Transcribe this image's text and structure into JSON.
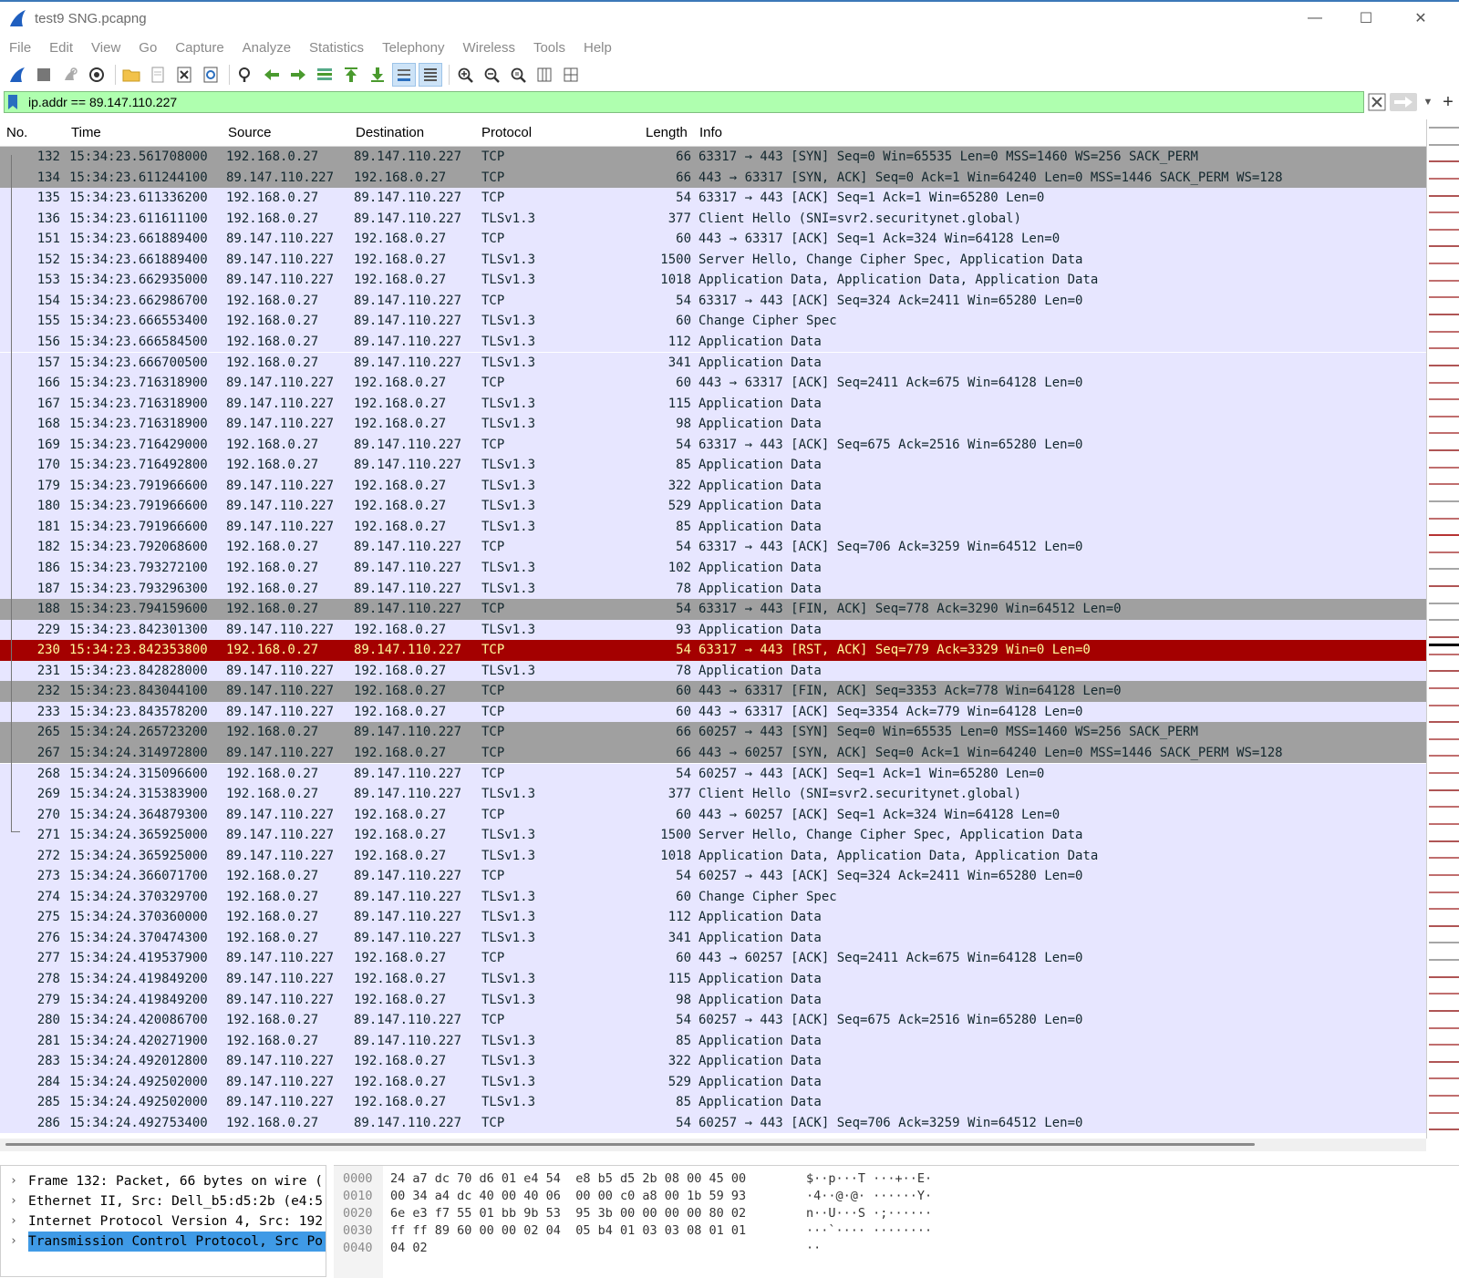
{
  "window": {
    "title": "test9 SNG.pcapng",
    "controls": {
      "minimize": "—",
      "maximize": "☐",
      "close": "✕"
    }
  },
  "menu": [
    "File",
    "Edit",
    "View",
    "Go",
    "Capture",
    "Analyze",
    "Statistics",
    "Telephony",
    "Wireless",
    "Tools",
    "Help"
  ],
  "toolbar": {
    "icons": [
      "shark-fin-start-icon",
      "stop-square-icon",
      "restart-icon",
      "capture-options-icon",
      "open-folder-icon",
      "save-file-icon",
      "close-file-icon",
      "reload-icon",
      "find-icon",
      "go-back-icon",
      "go-forward-icon",
      "go-to-packet-icon",
      "first-packet-icon",
      "last-packet-icon",
      "autoscroll-icon",
      "colorize-icon",
      "zoom-in-icon",
      "zoom-out-icon",
      "zoom-normal-icon",
      "resize-columns-icon",
      "layout-icon"
    ]
  },
  "filter": {
    "value": "ip.addr == 89.147.110.227",
    "add_button": "+"
  },
  "columns": {
    "no": "No.",
    "time": "Time",
    "source": "Source",
    "destination": "Destination",
    "protocol": "Protocol",
    "length": "Length",
    "info": "Info"
  },
  "colors": {
    "row_default": "#e7e6ff",
    "row_syn_fin": "#a0a0a0",
    "row_rst": "#a40000",
    "rst_text": "#fffc9c",
    "filter_bg": "#afffaf",
    "selected_detail": "#3f9ae6"
  },
  "packets": [
    {
      "no": "132",
      "time": "15:34:23.561708000",
      "src": "192.168.0.27",
      "dst": "89.147.110.227",
      "proto": "TCP",
      "len": "66",
      "info": "63317 → 443 [SYN] Seq=0 Win=65535 Len=0 MSS=1460 WS=256 SACK_PERM",
      "style": "syn"
    },
    {
      "no": "134",
      "time": "15:34:23.611244100",
      "src": "89.147.110.227",
      "dst": "192.168.0.27",
      "proto": "TCP",
      "len": "66",
      "info": "443 → 63317 [SYN, ACK] Seq=0 Ack=1 Win=64240 Len=0 MSS=1446 SACK_PERM WS=128",
      "style": "syn"
    },
    {
      "no": "135",
      "time": "15:34:23.611336200",
      "src": "192.168.0.27",
      "dst": "89.147.110.227",
      "proto": "TCP",
      "len": "54",
      "info": "63317 → 443 [ACK] Seq=1 Ack=1 Win=65280 Len=0",
      "style": "tcp"
    },
    {
      "no": "136",
      "time": "15:34:23.611611100",
      "src": "192.168.0.27",
      "dst": "89.147.110.227",
      "proto": "TLSv1.3",
      "len": "377",
      "info": "Client Hello (SNI=svr2.securitynet.global)",
      "style": "tls"
    },
    {
      "no": "151",
      "time": "15:34:23.661889400",
      "src": "89.147.110.227",
      "dst": "192.168.0.27",
      "proto": "TCP",
      "len": "60",
      "info": "443 → 63317 [ACK] Seq=1 Ack=324 Win=64128 Len=0",
      "style": "tcp"
    },
    {
      "no": "152",
      "time": "15:34:23.661889400",
      "src": "89.147.110.227",
      "dst": "192.168.0.27",
      "proto": "TLSv1.3",
      "len": "1500",
      "info": "Server Hello, Change Cipher Spec, Application Data",
      "style": "tls"
    },
    {
      "no": "153",
      "time": "15:34:23.662935000",
      "src": "89.147.110.227",
      "dst": "192.168.0.27",
      "proto": "TLSv1.3",
      "len": "1018",
      "info": "Application Data, Application Data, Application Data",
      "style": "tls"
    },
    {
      "no": "154",
      "time": "15:34:23.662986700",
      "src": "192.168.0.27",
      "dst": "89.147.110.227",
      "proto": "TCP",
      "len": "54",
      "info": "63317 → 443 [ACK] Seq=324 Ack=2411 Win=65280 Len=0",
      "style": "tcp"
    },
    {
      "no": "155",
      "time": "15:34:23.666553400",
      "src": "192.168.0.27",
      "dst": "89.147.110.227",
      "proto": "TLSv1.3",
      "len": "60",
      "info": "Change Cipher Spec",
      "style": "tls"
    },
    {
      "no": "156",
      "time": "15:34:23.666584500",
      "src": "192.168.0.27",
      "dst": "89.147.110.227",
      "proto": "TLSv1.3",
      "len": "112",
      "info": "Application Data",
      "style": "tls"
    },
    {
      "no": "157",
      "time": "15:34:23.666700500",
      "src": "192.168.0.27",
      "dst": "89.147.110.227",
      "proto": "TLSv1.3",
      "len": "341",
      "info": "Application Data",
      "style": "tls"
    },
    {
      "no": "166",
      "time": "15:34:23.716318900",
      "src": "89.147.110.227",
      "dst": "192.168.0.27",
      "proto": "TCP",
      "len": "60",
      "info": "443 → 63317 [ACK] Seq=2411 Ack=675 Win=64128 Len=0",
      "style": "tcp"
    },
    {
      "no": "167",
      "time": "15:34:23.716318900",
      "src": "89.147.110.227",
      "dst": "192.168.0.27",
      "proto": "TLSv1.3",
      "len": "115",
      "info": "Application Data",
      "style": "tls"
    },
    {
      "no": "168",
      "time": "15:34:23.716318900",
      "src": "89.147.110.227",
      "dst": "192.168.0.27",
      "proto": "TLSv1.3",
      "len": "98",
      "info": "Application Data",
      "style": "tls"
    },
    {
      "no": "169",
      "time": "15:34:23.716429000",
      "src": "192.168.0.27",
      "dst": "89.147.110.227",
      "proto": "TCP",
      "len": "54",
      "info": "63317 → 443 [ACK] Seq=675 Ack=2516 Win=65280 Len=0",
      "style": "tcp"
    },
    {
      "no": "170",
      "time": "15:34:23.716492800",
      "src": "192.168.0.27",
      "dst": "89.147.110.227",
      "proto": "TLSv1.3",
      "len": "85",
      "info": "Application Data",
      "style": "tls"
    },
    {
      "no": "179",
      "time": "15:34:23.791966600",
      "src": "89.147.110.227",
      "dst": "192.168.0.27",
      "proto": "TLSv1.3",
      "len": "322",
      "info": "Application Data",
      "style": "tls"
    },
    {
      "no": "180",
      "time": "15:34:23.791966600",
      "src": "89.147.110.227",
      "dst": "192.168.0.27",
      "proto": "TLSv1.3",
      "len": "529",
      "info": "Application Data",
      "style": "tls"
    },
    {
      "no": "181",
      "time": "15:34:23.791966600",
      "src": "89.147.110.227",
      "dst": "192.168.0.27",
      "proto": "TLSv1.3",
      "len": "85",
      "info": "Application Data",
      "style": "tls"
    },
    {
      "no": "182",
      "time": "15:34:23.792068600",
      "src": "192.168.0.27",
      "dst": "89.147.110.227",
      "proto": "TCP",
      "len": "54",
      "info": "63317 → 443 [ACK] Seq=706 Ack=3259 Win=64512 Len=0",
      "style": "tcp"
    },
    {
      "no": "186",
      "time": "15:34:23.793272100",
      "src": "192.168.0.27",
      "dst": "89.147.110.227",
      "proto": "TLSv1.3",
      "len": "102",
      "info": "Application Data",
      "style": "tls"
    },
    {
      "no": "187",
      "time": "15:34:23.793296300",
      "src": "192.168.0.27",
      "dst": "89.147.110.227",
      "proto": "TLSv1.3",
      "len": "78",
      "info": "Application Data",
      "style": "tls"
    },
    {
      "no": "188",
      "time": "15:34:23.794159600",
      "src": "192.168.0.27",
      "dst": "89.147.110.227",
      "proto": "TCP",
      "len": "54",
      "info": "63317 → 443 [FIN, ACK] Seq=778 Ack=3290 Win=64512 Len=0",
      "style": "syn"
    },
    {
      "no": "229",
      "time": "15:34:23.842301300",
      "src": "89.147.110.227",
      "dst": "192.168.0.27",
      "proto": "TLSv1.3",
      "len": "93",
      "info": "Application Data",
      "style": "tls"
    },
    {
      "no": "230",
      "time": "15:34:23.842353800",
      "src": "192.168.0.27",
      "dst": "89.147.110.227",
      "proto": "TCP",
      "len": "54",
      "info": "63317 → 443 [RST, ACK] Seq=779 Ack=3329 Win=0 Len=0",
      "style": "rst"
    },
    {
      "no": "231",
      "time": "15:34:23.842828000",
      "src": "89.147.110.227",
      "dst": "192.168.0.27",
      "proto": "TLSv1.3",
      "len": "78",
      "info": "Application Data",
      "style": "tls"
    },
    {
      "no": "232",
      "time": "15:34:23.843044100",
      "src": "89.147.110.227",
      "dst": "192.168.0.27",
      "proto": "TCP",
      "len": "60",
      "info": "443 → 63317 [FIN, ACK] Seq=3353 Ack=778 Win=64128 Len=0",
      "style": "syn"
    },
    {
      "no": "233",
      "time": "15:34:23.843578200",
      "src": "89.147.110.227",
      "dst": "192.168.0.27",
      "proto": "TCP",
      "len": "60",
      "info": "443 → 63317 [ACK] Seq=3354 Ack=779 Win=64128 Len=0",
      "style": "tcp"
    },
    {
      "no": "265",
      "time": "15:34:24.265723200",
      "src": "192.168.0.27",
      "dst": "89.147.110.227",
      "proto": "TCP",
      "len": "66",
      "info": "60257 → 443 [SYN] Seq=0 Win=65535 Len=0 MSS=1460 WS=256 SACK_PERM",
      "style": "syn"
    },
    {
      "no": "267",
      "time": "15:34:24.314972800",
      "src": "89.147.110.227",
      "dst": "192.168.0.27",
      "proto": "TCP",
      "len": "66",
      "info": "443 → 60257 [SYN, ACK] Seq=0 Ack=1 Win=64240 Len=0 MSS=1446 SACK_PERM WS=128",
      "style": "syn"
    },
    {
      "no": "268",
      "time": "15:34:24.315096600",
      "src": "192.168.0.27",
      "dst": "89.147.110.227",
      "proto": "TCP",
      "len": "54",
      "info": "60257 → 443 [ACK] Seq=1 Ack=1 Win=65280 Len=0",
      "style": "tcp"
    },
    {
      "no": "269",
      "time": "15:34:24.315383900",
      "src": "192.168.0.27",
      "dst": "89.147.110.227",
      "proto": "TLSv1.3",
      "len": "377",
      "info": "Client Hello (SNI=svr2.securitynet.global)",
      "style": "tls"
    },
    {
      "no": "270",
      "time": "15:34:24.364879300",
      "src": "89.147.110.227",
      "dst": "192.168.0.27",
      "proto": "TCP",
      "len": "60",
      "info": "443 → 60257 [ACK] Seq=1 Ack=324 Win=64128 Len=0",
      "style": "tcp"
    },
    {
      "no": "271",
      "time": "15:34:24.365925000",
      "src": "89.147.110.227",
      "dst": "192.168.0.27",
      "proto": "TLSv1.3",
      "len": "1500",
      "info": "Server Hello, Change Cipher Spec, Application Data",
      "style": "tls"
    },
    {
      "no": "272",
      "time": "15:34:24.365925000",
      "src": "89.147.110.227",
      "dst": "192.168.0.27",
      "proto": "TLSv1.3",
      "len": "1018",
      "info": "Application Data, Application Data, Application Data",
      "style": "tls"
    },
    {
      "no": "273",
      "time": "15:34:24.366071700",
      "src": "192.168.0.27",
      "dst": "89.147.110.227",
      "proto": "TCP",
      "len": "54",
      "info": "60257 → 443 [ACK] Seq=324 Ack=2411 Win=65280 Len=0",
      "style": "tcp"
    },
    {
      "no": "274",
      "time": "15:34:24.370329700",
      "src": "192.168.0.27",
      "dst": "89.147.110.227",
      "proto": "TLSv1.3",
      "len": "60",
      "info": "Change Cipher Spec",
      "style": "tls"
    },
    {
      "no": "275",
      "time": "15:34:24.370360000",
      "src": "192.168.0.27",
      "dst": "89.147.110.227",
      "proto": "TLSv1.3",
      "len": "112",
      "info": "Application Data",
      "style": "tls"
    },
    {
      "no": "276",
      "time": "15:34:24.370474300",
      "src": "192.168.0.27",
      "dst": "89.147.110.227",
      "proto": "TLSv1.3",
      "len": "341",
      "info": "Application Data",
      "style": "tls"
    },
    {
      "no": "277",
      "time": "15:34:24.419537900",
      "src": "89.147.110.227",
      "dst": "192.168.0.27",
      "proto": "TCP",
      "len": "60",
      "info": "443 → 60257 [ACK] Seq=2411 Ack=675 Win=64128 Len=0",
      "style": "tcp"
    },
    {
      "no": "278",
      "time": "15:34:24.419849200",
      "src": "89.147.110.227",
      "dst": "192.168.0.27",
      "proto": "TLSv1.3",
      "len": "115",
      "info": "Application Data",
      "style": "tls"
    },
    {
      "no": "279",
      "time": "15:34:24.419849200",
      "src": "89.147.110.227",
      "dst": "192.168.0.27",
      "proto": "TLSv1.3",
      "len": "98",
      "info": "Application Data",
      "style": "tls"
    },
    {
      "no": "280",
      "time": "15:34:24.420086700",
      "src": "192.168.0.27",
      "dst": "89.147.110.227",
      "proto": "TCP",
      "len": "54",
      "info": "60257 → 443 [ACK] Seq=675 Ack=2516 Win=65280 Len=0",
      "style": "tcp"
    },
    {
      "no": "281",
      "time": "15:34:24.420271900",
      "src": "192.168.0.27",
      "dst": "89.147.110.227",
      "proto": "TLSv1.3",
      "len": "85",
      "info": "Application Data",
      "style": "tls"
    },
    {
      "no": "283",
      "time": "15:34:24.492012800",
      "src": "89.147.110.227",
      "dst": "192.168.0.27",
      "proto": "TLSv1.3",
      "len": "322",
      "info": "Application Data",
      "style": "tls"
    },
    {
      "no": "284",
      "time": "15:34:24.492502000",
      "src": "89.147.110.227",
      "dst": "192.168.0.27",
      "proto": "TLSv1.3",
      "len": "529",
      "info": "Application Data",
      "style": "tls"
    },
    {
      "no": "285",
      "time": "15:34:24.492502000",
      "src": "89.147.110.227",
      "dst": "192.168.0.27",
      "proto": "TLSv1.3",
      "len": "85",
      "info": "Application Data",
      "style": "tls"
    },
    {
      "no": "286",
      "time": "15:34:24.492753400",
      "src": "192.168.0.27",
      "dst": "89.147.110.227",
      "proto": "TCP",
      "len": "54",
      "info": "60257 → 443 [ACK] Seq=706 Ack=3259 Win=64512 Len=0",
      "style": "tcp"
    }
  ],
  "details": [
    {
      "text": "Frame 132: Packet, 66 bytes on wire (",
      "selected": false
    },
    {
      "text": "Ethernet II, Src: Dell_b5:d5:2b (e4:5",
      "selected": false
    },
    {
      "text": "Internet Protocol Version 4, Src: 192",
      "selected": false
    },
    {
      "text": "Transmission Control Protocol, Src Po",
      "selected": true
    }
  ],
  "bytes": [
    {
      "offset": "0000",
      "hex": "24 a7 dc 70 d6 01 e4 54  e8 b5 d5 2b 08 00 45 00",
      "ascii": "$··p···T ···+··E·"
    },
    {
      "offset": "0010",
      "hex": "00 34 a4 dc 40 00 40 06  00 00 c0 a8 00 1b 59 93",
      "ascii": "·4··@·@· ······Y·"
    },
    {
      "offset": "0020",
      "hex": "6e e3 f7 55 01 bb 9b 53  95 3b 00 00 00 00 80 02",
      "ascii": "n··U···S ·;······"
    },
    {
      "offset": "0030",
      "hex": "ff ff 89 60 00 00 02 04  05 b4 01 03 03 08 01 01",
      "ascii": "···`···· ········"
    },
    {
      "offset": "0040",
      "hex": "04 02",
      "ascii": "··"
    }
  ]
}
